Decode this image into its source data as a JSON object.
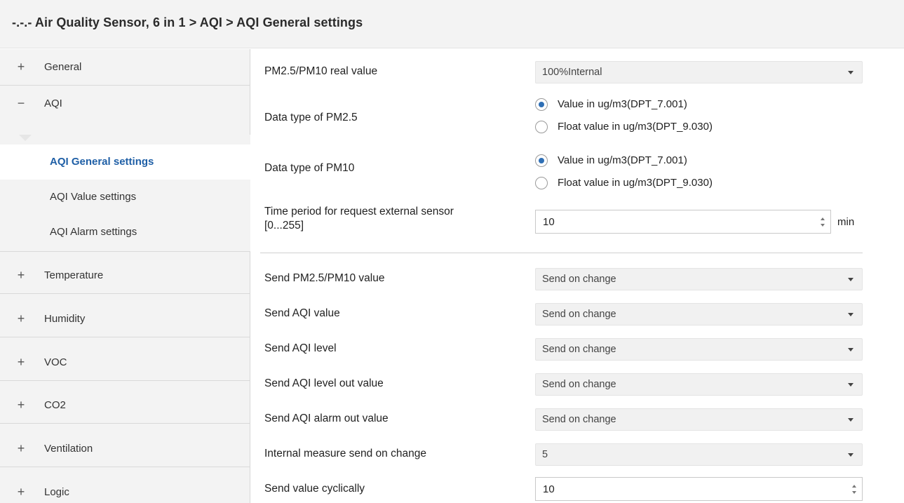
{
  "header": {
    "title": "-.-.- Air Quality Sensor, 6 in 1 > AQI > AQI General settings"
  },
  "sidebar": {
    "items": [
      {
        "sign": "+",
        "label": "General"
      },
      {
        "sign": "−",
        "label": "AQI"
      },
      {
        "sign": "+",
        "label": "Temperature"
      },
      {
        "sign": "+",
        "label": "Humidity"
      },
      {
        "sign": "+",
        "label": "VOC"
      },
      {
        "sign": "+",
        "label": "CO2"
      },
      {
        "sign": "+",
        "label": "Ventilation"
      },
      {
        "sign": "+",
        "label": "Logic"
      }
    ],
    "subitems": [
      {
        "label": "AQI General settings"
      },
      {
        "label": "AQI Value settings"
      },
      {
        "label": "AQI Alarm settings"
      }
    ]
  },
  "form": {
    "pm_real_value": {
      "label": "PM2.5/PM10 real value",
      "value": "100%Internal"
    },
    "pm25_type": {
      "label": "Data type of PM2.5",
      "options": [
        "Value in ug/m3(DPT_7.001)",
        "Float value in ug/m3(DPT_9.030)"
      ]
    },
    "pm10_type": {
      "label": "Data type of PM10",
      "options": [
        "Value in ug/m3(DPT_7.001)",
        "Float value in ug/m3(DPT_9.030)"
      ]
    },
    "time_period": {
      "label_line1": "Time period for request external sensor",
      "label_line2": "[0...255]",
      "value": "10",
      "unit": "min"
    },
    "send_pm": {
      "label": "Send PM2.5/PM10 value",
      "value": "Send on change"
    },
    "send_aqi_value": {
      "label": "Send AQI value",
      "value": "Send on change"
    },
    "send_aqi_level": {
      "label": "Send AQI level",
      "value": "Send on change"
    },
    "send_aqi_level_out": {
      "label": "Send AQI level out value",
      "value": "Send on change"
    },
    "send_aqi_alarm_out": {
      "label": "Send AQI alarm out value",
      "value": "Send on change"
    },
    "internal_measure": {
      "label": "Internal measure send on change",
      "value": "5"
    },
    "send_cyclic": {
      "label": "Send value cyclically",
      "value": "10"
    }
  }
}
